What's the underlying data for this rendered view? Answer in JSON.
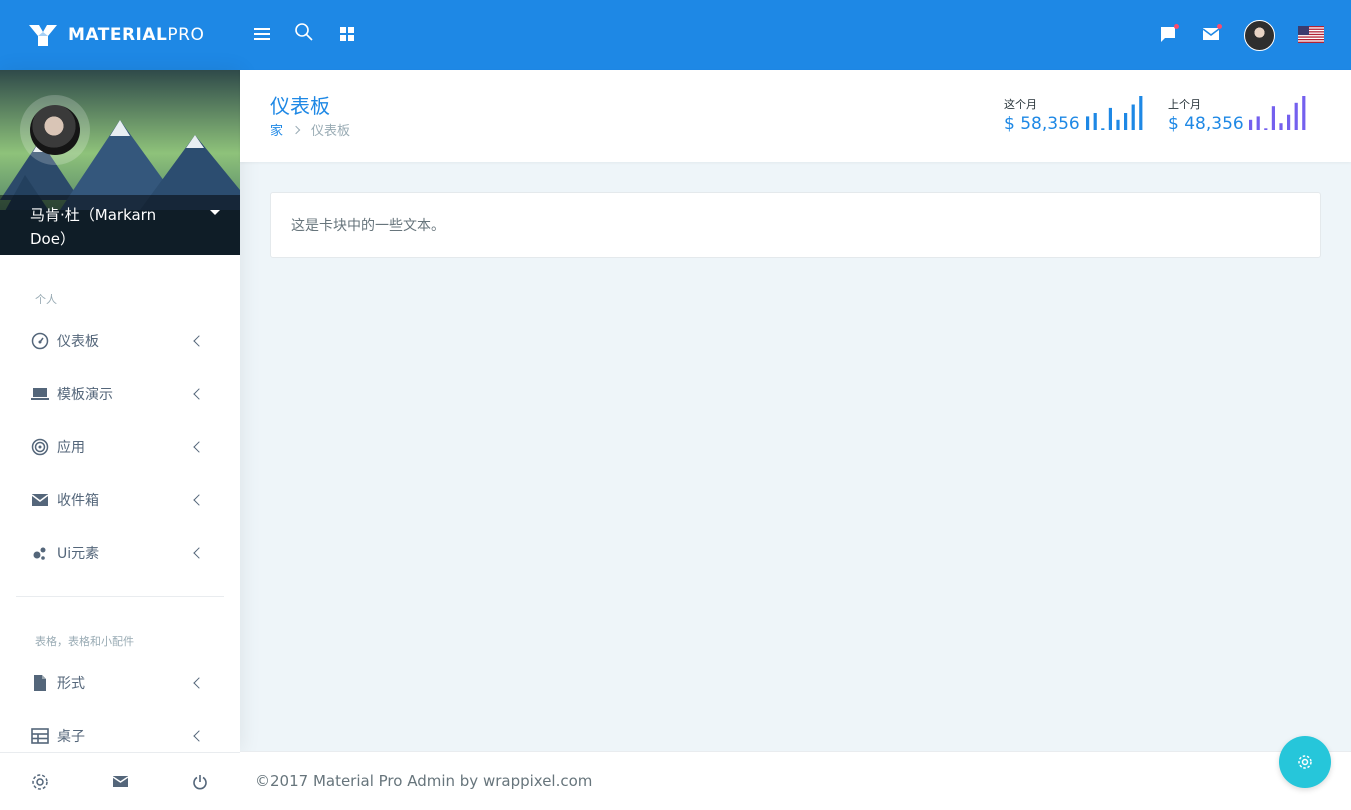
{
  "brand": {
    "name_bold": "MATERIAL",
    "name_light": "PRO"
  },
  "topbar": {
    "icons": [
      "menu-icon",
      "search-icon",
      "apps-icon",
      "chat-icon",
      "mail-icon",
      "user-avatar",
      "us-flag-icon"
    ]
  },
  "profile": {
    "name": "马肯·杜（Markarn Doe）"
  },
  "sidebar": {
    "caption_personal": "个人",
    "items_personal": [
      {
        "label": "仪表板",
        "icon": "gauge-icon"
      },
      {
        "label": "模板演示",
        "icon": "laptop-icon"
      },
      {
        "label": "应用",
        "icon": "target-icon"
      },
      {
        "label": "收件箱",
        "icon": "email-icon"
      },
      {
        "label": "Ui元素",
        "icon": "bubbles-icon"
      }
    ],
    "caption_forms": "表格，表格和小配件",
    "items_forms": [
      {
        "label": "形式",
        "icon": "file-icon"
      },
      {
        "label": "桌子",
        "icon": "table-icon"
      }
    ],
    "footer_icons": [
      "settings-icon",
      "mail-icon",
      "power-icon"
    ]
  },
  "page": {
    "title": "仪表板",
    "breadcrumb_home": "家",
    "breadcrumb_current": "仪表板"
  },
  "stats": [
    {
      "label": "这个月",
      "value": "$ 58,356",
      "color": "#1e88e5",
      "bars": [
        0.4,
        0.5,
        0.05,
        0.65,
        0.3,
        0.5,
        0.75,
        1.0
      ]
    },
    {
      "label": "上个月",
      "value": "$ 48,356",
      "color": "#7460ee",
      "bars": [
        0.3,
        0.4,
        0.05,
        0.7,
        0.2,
        0.45,
        0.8,
        1.0
      ]
    }
  ],
  "card": {
    "text": "这是卡块中的一些文本。"
  },
  "footer": {
    "text": "©2017 Material Pro Admin by wrappixel.com"
  },
  "colors": {
    "primary": "#1e88e5",
    "accent": "#26c6da",
    "purple": "#7460ee",
    "badge": "#fc4b6c"
  }
}
